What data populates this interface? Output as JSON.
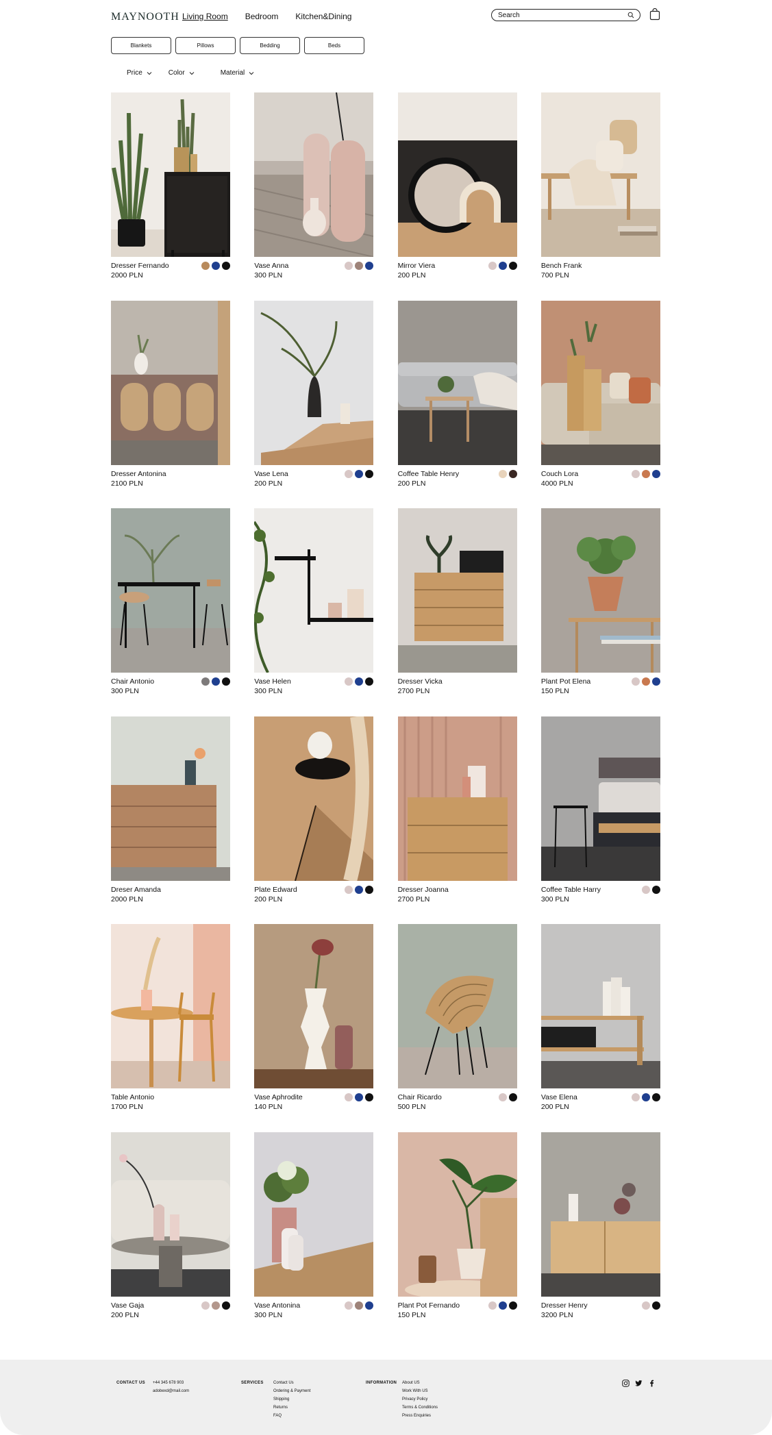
{
  "brand": {
    "logo": "MAYNOOTH"
  },
  "nav": {
    "items": [
      "Living Room",
      "Bedroom",
      "Kitchen&Dining"
    ]
  },
  "search": {
    "value": "Search",
    "icon": "search-icon"
  },
  "categories": [
    "Blankets",
    "Pillows",
    "Bedding",
    "Beds"
  ],
  "filters": [
    "Price",
    "Color",
    "Material"
  ],
  "colors": {
    "ochre": "#b88a5c",
    "navy": "#1f3f8f",
    "black": "#111111",
    "blush": "#d8c7c6",
    "mauve": "#9e8379",
    "grey": "#7d7a7a",
    "terracotta": "#c9794f",
    "sand": "#e8d3bb",
    "espresso": "#3a2723",
    "rosybeige": "#b3978c"
  },
  "products": [
    {
      "name": "Dresser Fernando",
      "price": "2000 PLN",
      "swatches": [
        "#b88a5c",
        "#1f3f8f",
        "#111111"
      ]
    },
    {
      "name": "Vase Anna",
      "price": "300 PLN",
      "swatches": [
        "#d8c7c6",
        "#9e8379",
        "#1f3f8f"
      ]
    },
    {
      "name": "Mirror Viera",
      "price": "200 PLN",
      "swatches": [
        "#d8c7c6",
        "#1f3f8f",
        "#111111"
      ]
    },
    {
      "name": "Bench Frank",
      "price": "700 PLN",
      "swatches": []
    },
    {
      "name": "Dresser Antonina",
      "price": "2100 PLN",
      "swatches": []
    },
    {
      "name": "Vase Lena",
      "price": "200 PLN",
      "swatches": [
        "#d8c7c6",
        "#1f3f8f",
        "#111111"
      ]
    },
    {
      "name": "Coffee Table Henry",
      "price": "200 PLN",
      "swatches": [
        "#e8d3bb",
        "#3a2723"
      ]
    },
    {
      "name": "Couch Lora",
      "price": "4000 PLN",
      "swatches": [
        "#d8c7c6",
        "#c9794f",
        "#1f3f8f"
      ]
    },
    {
      "name": "Chair Antonio",
      "price": "300 PLN",
      "swatches": [
        "#7d7a7a",
        "#1f3f8f",
        "#111111"
      ]
    },
    {
      "name": "Vase Helen",
      "price": "300 PLN",
      "swatches": [
        "#d8c7c6",
        "#1f3f8f",
        "#111111"
      ]
    },
    {
      "name": "Dresser Vicka",
      "price": "2700 PLN",
      "swatches": []
    },
    {
      "name": "Plant Pot Elena",
      "price": "150 PLN",
      "swatches": [
        "#d8c7c6",
        "#c9794f",
        "#1f3f8f"
      ]
    },
    {
      "name": "Dreser Amanda",
      "price": "2000 PLN",
      "swatches": []
    },
    {
      "name": "Plate Edward",
      "price": "200 PLN",
      "swatches": [
        "#d8c7c6",
        "#1f3f8f",
        "#111111"
      ]
    },
    {
      "name": "Dresser Joanna",
      "price": "2700 PLN",
      "swatches": []
    },
    {
      "name": "Coffee Table Harry",
      "price": "300 PLN",
      "swatches": [
        "#d8c7c6",
        "#111111"
      ]
    },
    {
      "name": "Table Antonio",
      "price": "1700 PLN",
      "swatches": []
    },
    {
      "name": "Vase Aphrodite",
      "price": "140 PLN",
      "swatches": [
        "#d8c7c6",
        "#1f3f8f",
        "#111111"
      ]
    },
    {
      "name": "Chair Ricardo",
      "price": "500 PLN",
      "swatches": [
        "#d8c7c6",
        "#111111"
      ]
    },
    {
      "name": "Vase Elena",
      "price": "200 PLN",
      "swatches": [
        "#d8c7c6",
        "#1f3f8f",
        "#111111"
      ]
    },
    {
      "name": "Vase Gaja",
      "price": "200 PLN",
      "swatches": [
        "#d8c7c6",
        "#b3978c",
        "#111111"
      ]
    },
    {
      "name": "Vase Antonina",
      "price": "300 PLN",
      "swatches": [
        "#d8c7c6",
        "#9e8379",
        "#1f3f8f"
      ]
    },
    {
      "name": "Plant Pot Fernando",
      "price": "150 PLN",
      "swatches": [
        "#d8c7c6",
        "#1f3f8f",
        "#111111"
      ]
    },
    {
      "name": "Dresser Henry",
      "price": "3200 PLN",
      "swatches": [
        "#d8c7c6",
        "#111111"
      ]
    }
  ],
  "footer": {
    "contact": {
      "heading": "CONTACT US",
      "lines": [
        "+44 345 678 903",
        "adobexd@mail.com"
      ]
    },
    "services": {
      "heading": "SERVICES",
      "lines": [
        "Contact Us",
        "Ordering & Payment",
        "Shipping",
        "Returns",
        "FAQ"
      ]
    },
    "information": {
      "heading": "INFORMATION",
      "lines": [
        "About US",
        "Work With US",
        "Privacy Policy",
        "Terms & Conditions",
        "Press Enquiries"
      ]
    },
    "social": [
      "instagram-icon",
      "twitter-icon",
      "facebook-icon"
    ]
  }
}
